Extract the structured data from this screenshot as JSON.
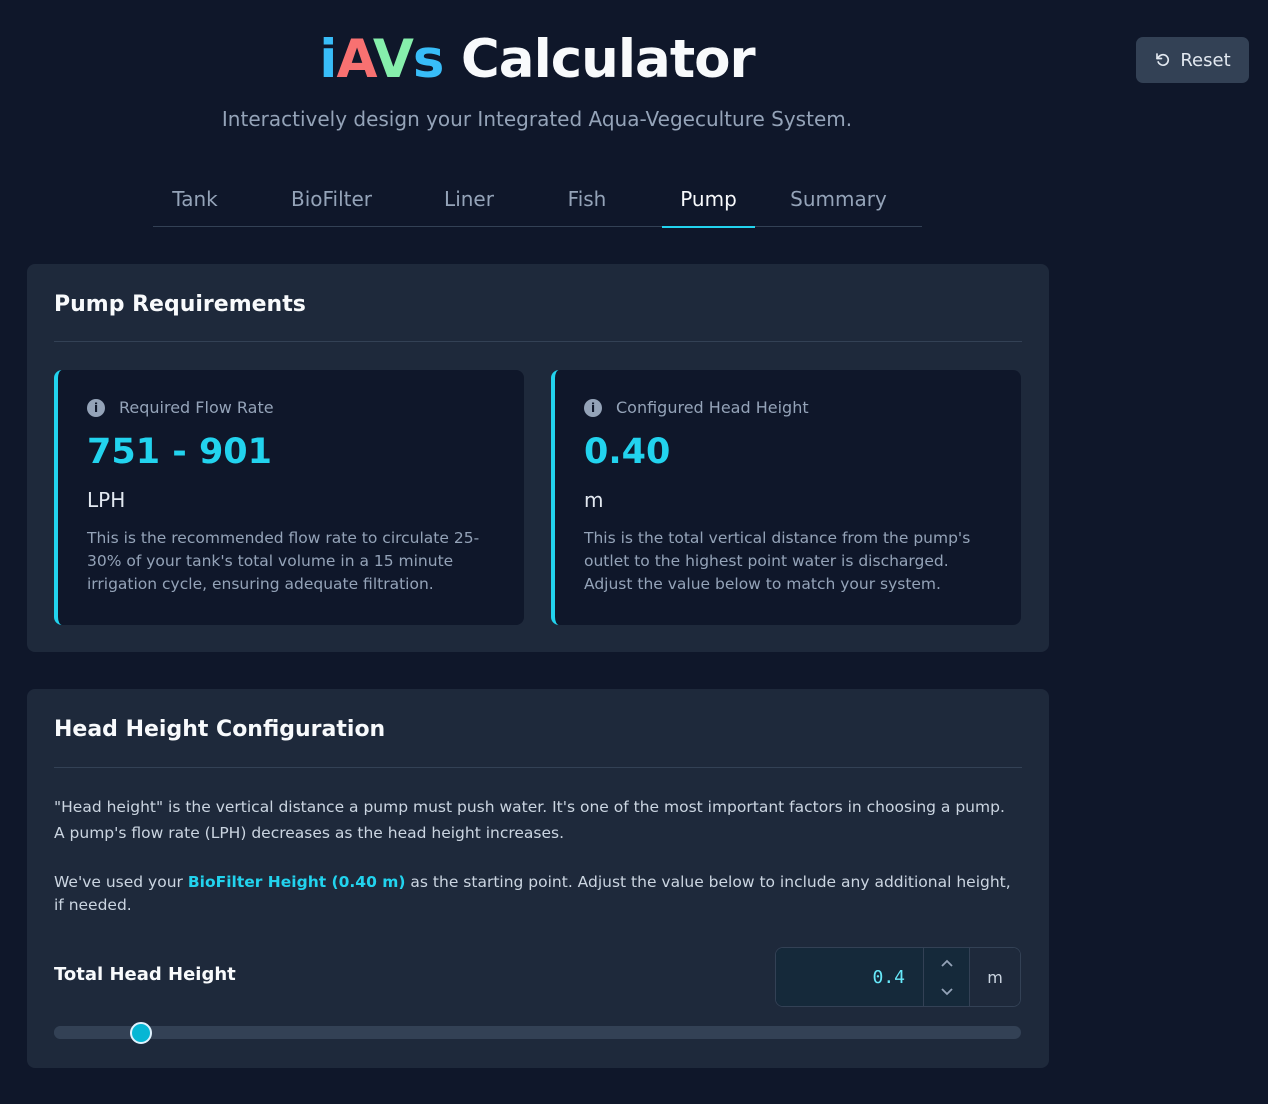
{
  "header": {
    "title_parts": [
      "i",
      "A",
      "V",
      "s"
    ],
    "title_rest": "Calculator",
    "subtitle": "Interactively design your Integrated Aqua-Vegeculture System.",
    "reset_label": "Reset"
  },
  "tabs": [
    {
      "label": "Tank",
      "active": false
    },
    {
      "label": "BioFilter",
      "active": false
    },
    {
      "label": "Liner",
      "active": false
    },
    {
      "label": "Fish",
      "active": false
    },
    {
      "label": "Pump",
      "active": true
    },
    {
      "label": "Summary",
      "active": false
    }
  ],
  "pump_requirements": {
    "title": "Pump Requirements",
    "flow_rate": {
      "label": "Required Flow Rate",
      "value": "751 - 901",
      "unit": "LPH",
      "description": "This is the recommended flow rate to circulate 25-30% of your tank's total volume in a 15 minute irrigation cycle, ensuring adequate filtration."
    },
    "head_height": {
      "label": "Configured Head Height",
      "value": "0.40",
      "unit": "m",
      "description": "This is the total vertical distance from the pump's outlet to the highest point water is discharged. Adjust the value below to match your system."
    }
  },
  "head_config": {
    "title": "Head Height Configuration",
    "para1": "\"Head height\" is the vertical distance a pump must push water. It's one of the most important factors in choosing a pump. A pump's flow rate (LPH) decreases as the head height increases.",
    "para2_before": "We've used your ",
    "para2_highlight": "BioFilter Height (0.40 m)",
    "para2_after": " as the starting point. Adjust the value below to include any additional height, if needed.",
    "total_label": "Total Head Height",
    "input_value": "0.4",
    "unit": "m",
    "slider_fraction": 0.09
  },
  "colors": {
    "accent": "#22d3ee",
    "background": "#0f172a",
    "card": "#1e293b"
  }
}
